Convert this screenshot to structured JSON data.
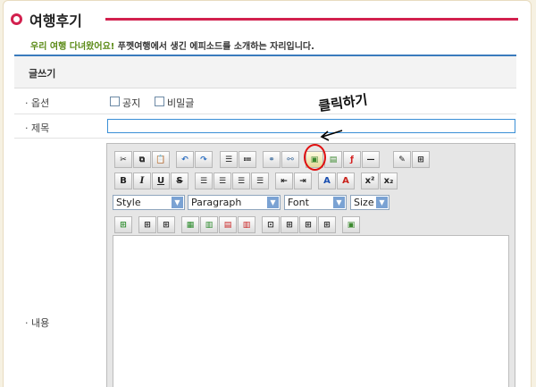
{
  "page": {
    "title": "여행후기",
    "subtitle_highlight": "우리 여행 다녀왔어요!",
    "subtitle_rest": " 푸껫여행에서 생긴 에피소드를 소개하는 자리입니다.",
    "section_title": "글쓰기"
  },
  "form": {
    "options_label": "· 옵션",
    "notice_label": "공지",
    "secret_label": "비밀글",
    "subject_label": "· 제목",
    "subject_value": "",
    "content_label": "· 내용"
  },
  "toolbar": {
    "row1": [
      "cut",
      "copy",
      "paste",
      "undo",
      "redo",
      "numbered-list",
      "bulleted-list",
      "link",
      "unlink",
      "image",
      "flash-upload",
      "flash",
      "horizontal-rule",
      "edit",
      "table-props"
    ],
    "row2": [
      "B",
      "I",
      "U",
      "S",
      "align-left",
      "align-center",
      "align-right",
      "align-justify",
      "outdent",
      "indent",
      "text-color",
      "bg-color",
      "x²",
      "x₂"
    ],
    "style_select": "Style",
    "paragraph_select": "Paragraph",
    "font_select": "Font",
    "size_select": "Size",
    "row4": [
      "table-insert",
      "insert-col-before",
      "insert-col-after",
      "insert-row",
      "delete-col",
      "delete-row",
      "delete-col-2",
      "merge-cells",
      "split-cells",
      "cell-props",
      "row-props",
      "image-2"
    ]
  },
  "annotation": {
    "text": "클릭하기",
    "colors": {
      "ring": "#e01010"
    }
  },
  "colors": {
    "accent": "#d2204e",
    "highlight": "#5a8a15",
    "rule": "#3a7bbd"
  }
}
